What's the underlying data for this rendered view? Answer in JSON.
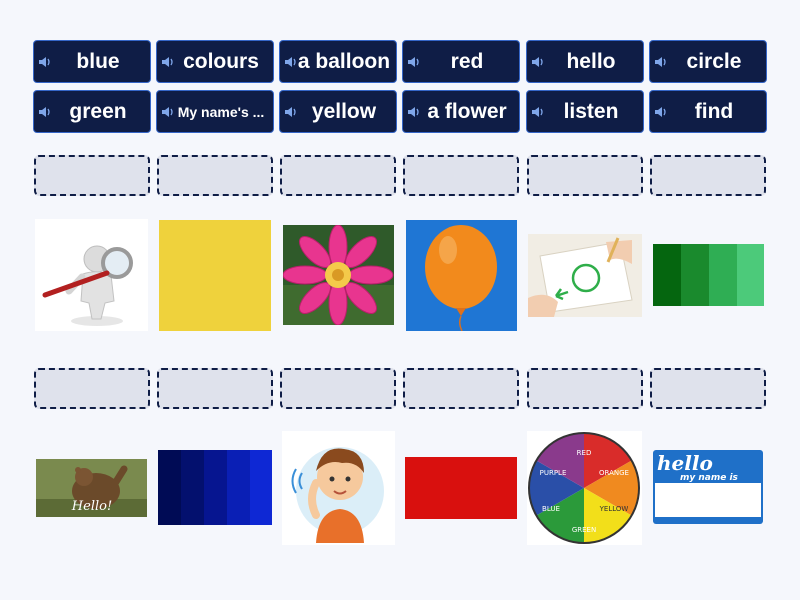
{
  "tiles": [
    {
      "label": "blue"
    },
    {
      "label": "colours"
    },
    {
      "label": "a balloon"
    },
    {
      "label": "red"
    },
    {
      "label": "hello"
    },
    {
      "label": "circle"
    },
    {
      "label": "green"
    },
    {
      "label": "My name's ..."
    },
    {
      "label": "yellow"
    },
    {
      "label": "a flower"
    },
    {
      "label": "listen"
    },
    {
      "label": "find"
    }
  ],
  "images": {
    "bear_caption": "Hello!",
    "wheel_labels": {
      "red": "RED",
      "orange": "ORANGE",
      "yellow": "YELLOW",
      "green": "GREEN",
      "blue": "BLUE",
      "purple": "PURPLE"
    },
    "name_tag": {
      "title": "hello",
      "subtitle": "my name is"
    }
  },
  "colors": {
    "tile_bg": "#0f1d46",
    "tile_border": "#3566c8",
    "slot_bg": "#dfe2ec",
    "page_bg": "#f5f7fc",
    "yellow_swatch": "#efd23c",
    "red_swatch": "#d9100e",
    "blue_swatch": "#0a1fb5"
  }
}
